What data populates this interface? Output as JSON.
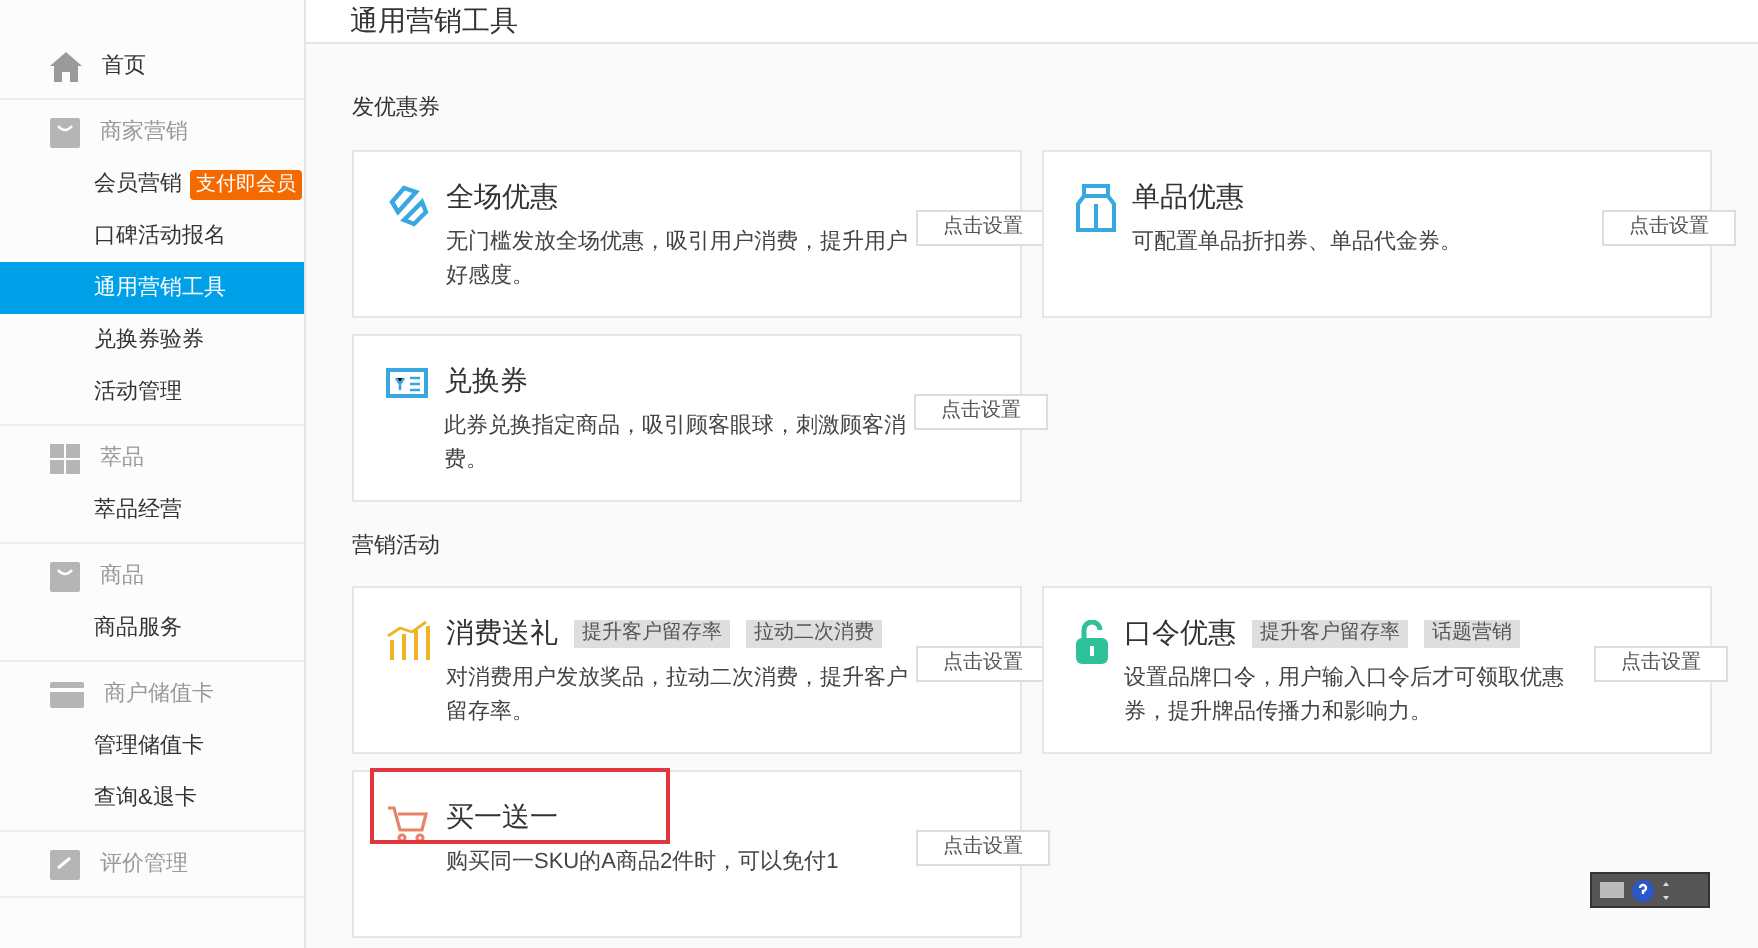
{
  "sidebar": {
    "groups": [
      {
        "title": "首页"
      },
      {
        "title": "商家营销",
        "items": [
          {
            "label": "会员营销",
            "badge": "支付即会员",
            "selected": false
          },
          {
            "label": "口碑活动报名",
            "selected": false
          },
          {
            "label": "通用营销工具",
            "selected": true
          },
          {
            "label": "兑换券验券",
            "selected": false
          },
          {
            "label": "活动管理",
            "selected": false
          }
        ]
      },
      {
        "title": "萃品",
        "items": [
          {
            "label": "萃品经营",
            "selected": false
          }
        ]
      },
      {
        "title": "商品",
        "items": [
          {
            "label": "商品服务",
            "selected": false
          }
        ]
      },
      {
        "title": "商户储值卡",
        "items": [
          {
            "label": "管理储值卡",
            "selected": false
          },
          {
            "label": "查询&退卡",
            "selected": false
          }
        ]
      },
      {
        "title": "评价管理"
      }
    ]
  },
  "page_title": "通用营销工具",
  "sections": [
    {
      "title": "发优惠券",
      "cards": [
        {
          "title": "全场优惠",
          "description": "无门槛发放全场优惠，吸引用户消费，提升用户好感度。",
          "button": "点击设置",
          "highlighted": false
        },
        {
          "title": "单品优惠",
          "description": "可配置单品折扣券、单品代金券。",
          "button": "点击设置",
          "highlighted": false
        },
        {
          "title": "兑换券",
          "description": "此券兑换指定商品，吸引顾客眼球，刺激顾客消费。",
          "button": "点击设置",
          "highlighted": false
        }
      ]
    },
    {
      "title": "营销活动",
      "cards": [
        {
          "title": "消费送礼",
          "tags": [
            "提升客户留存率",
            "拉动二次消费"
          ],
          "description": "对消费用户发放奖品，拉动二次消费，提升客户留存率。",
          "button": "点击设置",
          "highlighted": false
        },
        {
          "title": "口令优惠",
          "tags": [
            "提升客户留存率",
            "话题营销"
          ],
          "description": "设置品牌口令，用户输入口令后才可领取优惠券，提升牌品传播力和影响力。",
          "button": "点击设置",
          "highlighted": false
        },
        {
          "title": "买一送一",
          "description": "购买同一SKU的A商品2件时，可以免付1",
          "button": "点击设置",
          "highlighted": true
        }
      ]
    }
  ]
}
